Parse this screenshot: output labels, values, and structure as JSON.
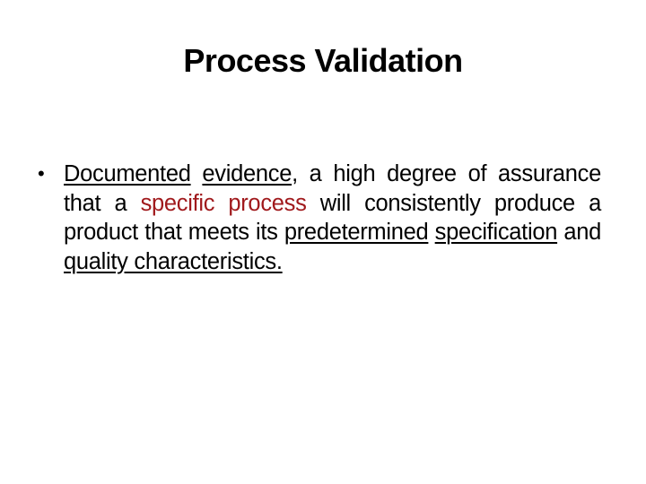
{
  "slide": {
    "title": "Process Validation",
    "accent_color": "#a0191c",
    "bullet_icon": "bullet-dot",
    "bullets": [
      {
        "segments": [
          {
            "text": "Documented",
            "style": "underline"
          },
          {
            "text": " ",
            "style": "plain"
          },
          {
            "text": "evidence",
            "style": "underline"
          },
          {
            "text": ", a high degree of assurance that a ",
            "style": "plain"
          },
          {
            "text": "specific process",
            "style": "red"
          },
          {
            "text": " will consistently produce a product that meets its ",
            "style": "plain"
          },
          {
            "text": "predetermined",
            "style": "underline"
          },
          {
            "text": " ",
            "style": "plain"
          },
          {
            "text": "specification",
            "style": "underline"
          },
          {
            "text": " and ",
            "style": "plain"
          },
          {
            "text": "quality characteristics.",
            "style": "underline"
          }
        ]
      }
    ]
  }
}
